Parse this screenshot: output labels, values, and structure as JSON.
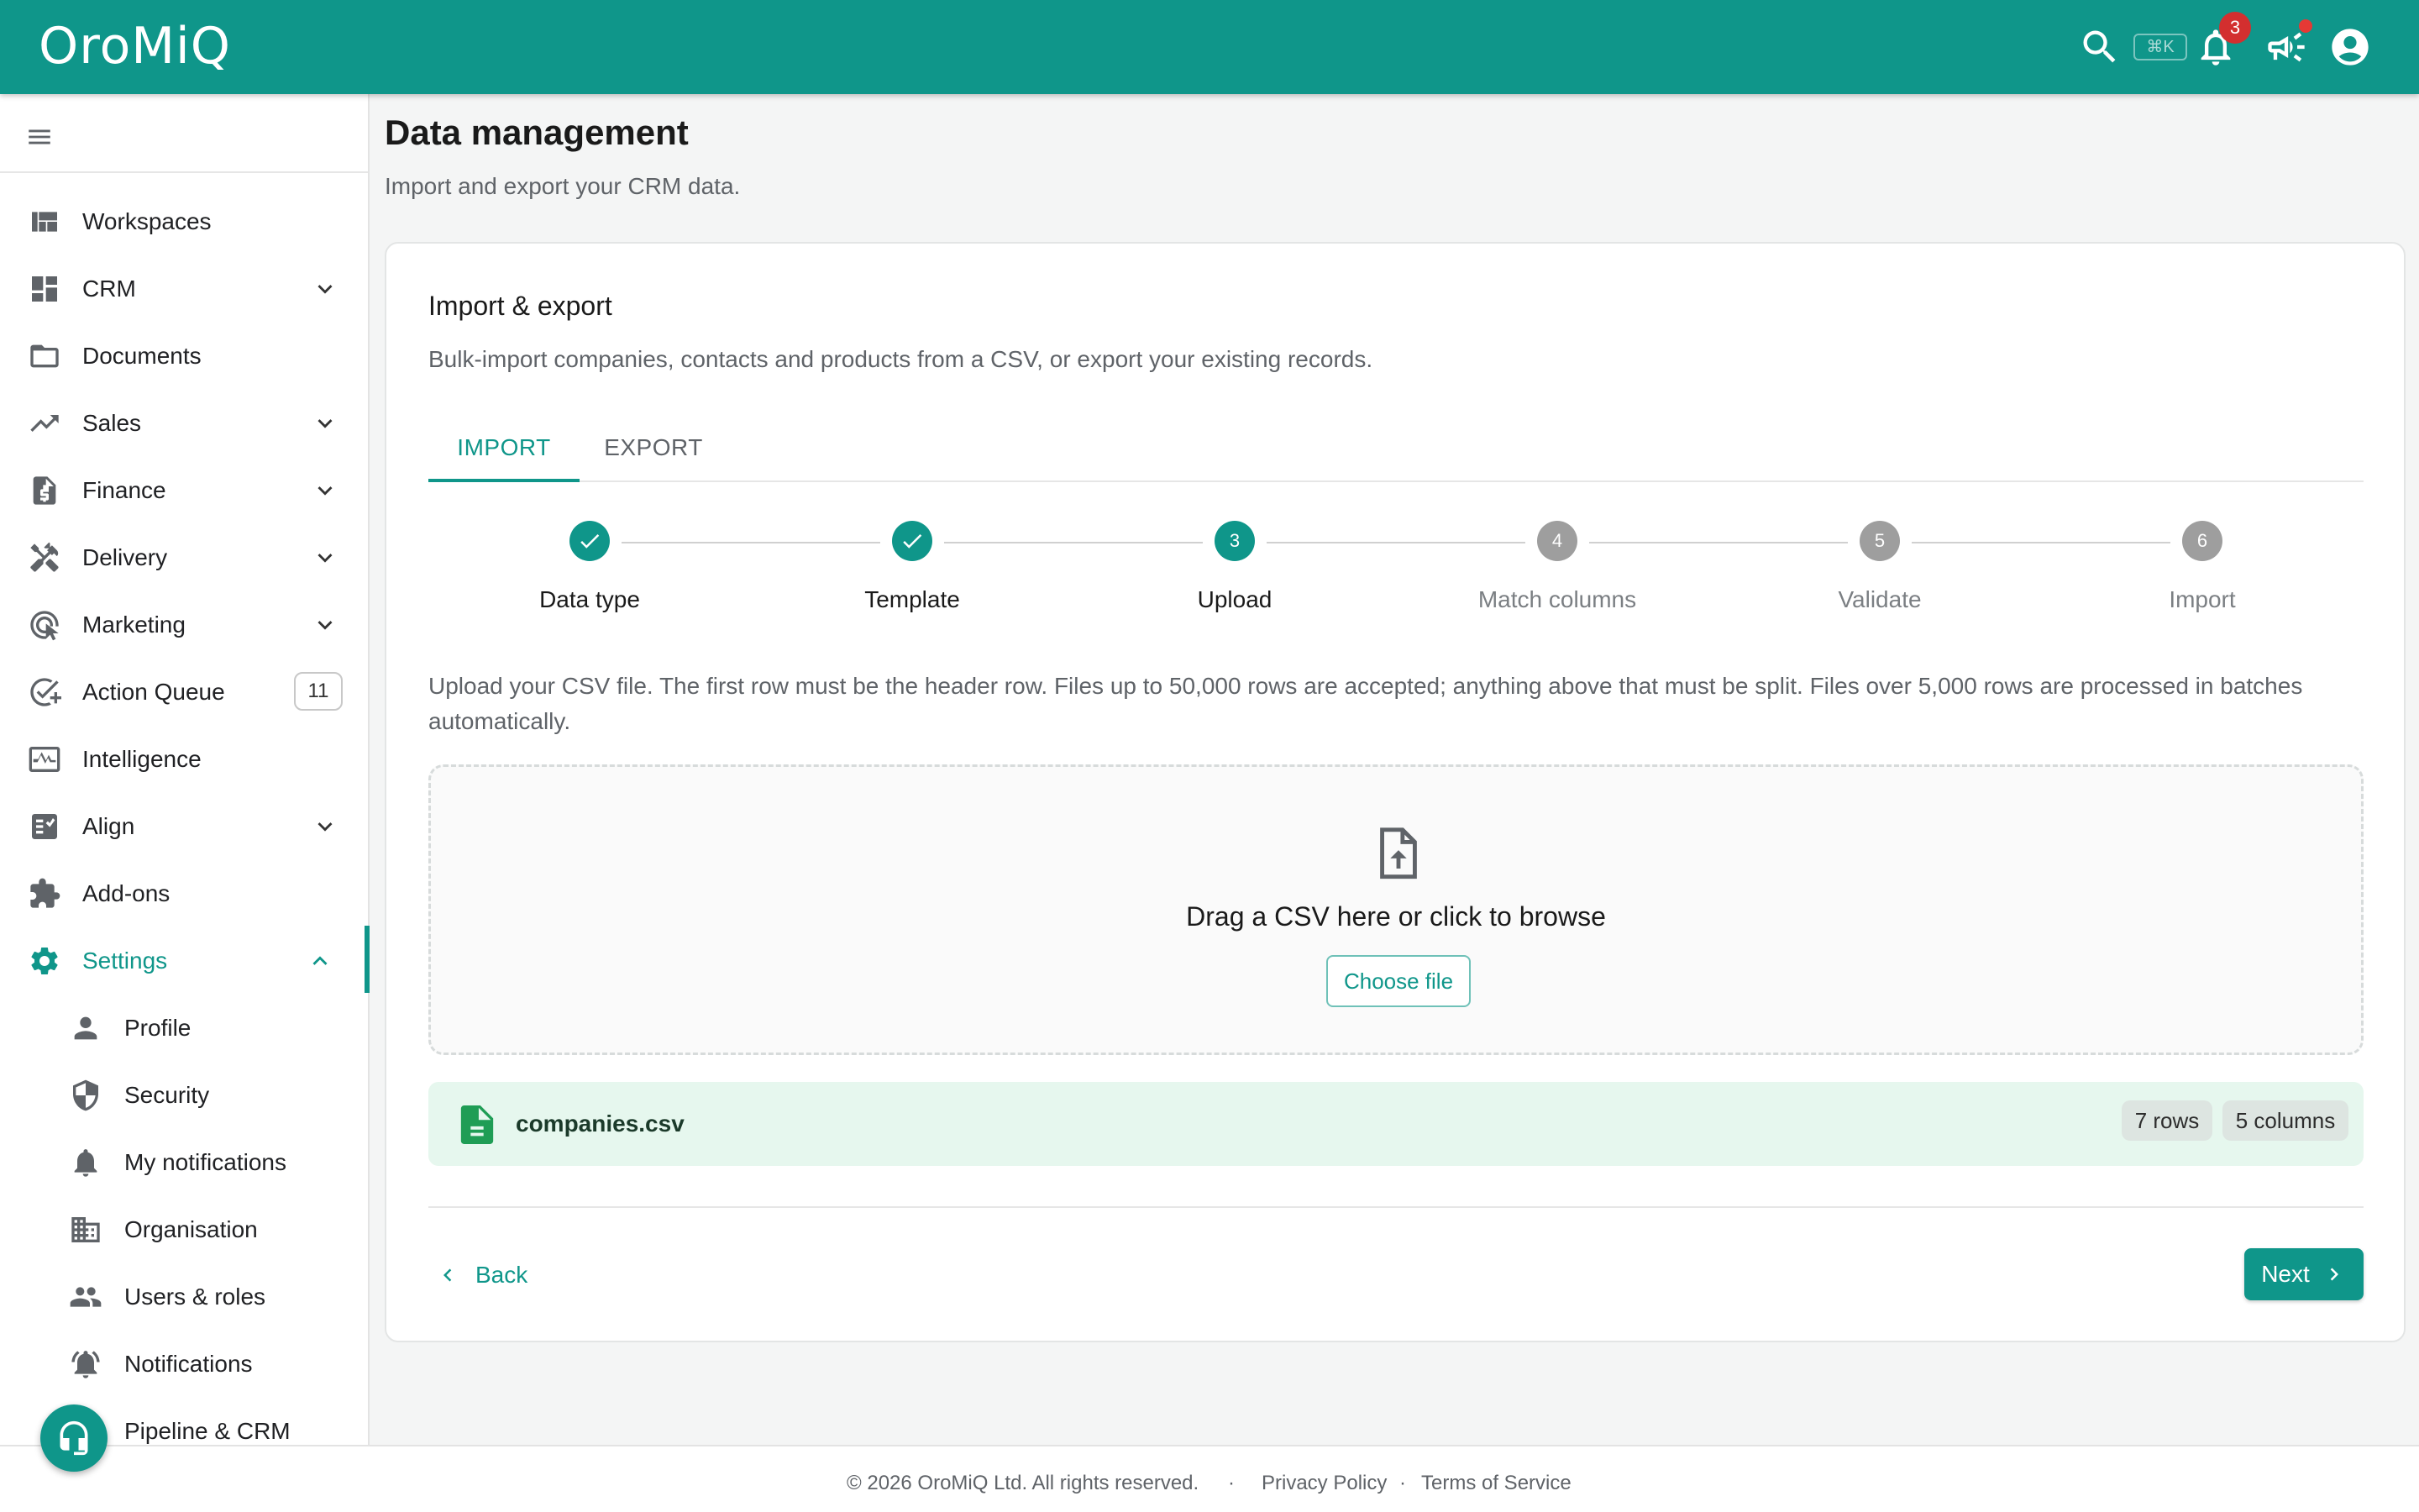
{
  "app": {
    "logo": "OroMiQ"
  },
  "topbar": {
    "shortcut": "⌘K",
    "notification_count": "3",
    "icons": [
      "search-icon",
      "bell-icon",
      "megaphone-icon",
      "account-icon"
    ]
  },
  "sidebar": {
    "items": [
      {
        "label": "Workspaces",
        "icon": "dashboard-icon"
      },
      {
        "label": "CRM",
        "icon": "grid-icon",
        "expandable": true
      },
      {
        "label": "Documents",
        "icon": "folder-icon"
      },
      {
        "label": "Sales",
        "icon": "trending-up-icon",
        "expandable": true
      },
      {
        "label": "Finance",
        "icon": "invoice-icon",
        "expandable": true
      },
      {
        "label": "Delivery",
        "icon": "tools-icon",
        "expandable": true
      },
      {
        "label": "Marketing",
        "icon": "target-icon",
        "expandable": true
      },
      {
        "label": "Action Queue",
        "icon": "check-circle-icon",
        "badge": "11"
      },
      {
        "label": "Intelligence",
        "icon": "pulse-icon"
      },
      {
        "label": "Align",
        "icon": "checklist-icon",
        "expandable": true
      },
      {
        "label": "Add-ons",
        "icon": "puzzle-icon"
      },
      {
        "label": "Settings",
        "icon": "gear-icon",
        "expanded": true,
        "active": true
      }
    ],
    "settings_sub": [
      {
        "label": "Profile",
        "icon": "person-icon"
      },
      {
        "label": "Security",
        "icon": "shield-icon"
      },
      {
        "label": "My notifications",
        "icon": "bell-icon"
      },
      {
        "label": "Organisation",
        "icon": "building-icon"
      },
      {
        "label": "Users & roles",
        "icon": "people-icon"
      },
      {
        "label": "Notifications",
        "icon": "bell-ring-icon"
      },
      {
        "label": "Pipeline & CRM",
        "icon": "pipeline-icon"
      }
    ]
  },
  "page": {
    "title": "Data management",
    "subtitle": "Import and export your CRM data."
  },
  "card": {
    "title": "Import & export",
    "description": "Bulk-import companies, contacts and products from a CSV, or export your existing records.",
    "tabs": [
      {
        "label": "IMPORT",
        "active": true
      },
      {
        "label": "EXPORT",
        "active": false
      }
    ],
    "steps": [
      {
        "number": "1",
        "label": "Data type",
        "state": "done"
      },
      {
        "number": "2",
        "label": "Template",
        "state": "done"
      },
      {
        "number": "3",
        "label": "Upload",
        "state": "current"
      },
      {
        "number": "4",
        "label": "Match columns",
        "state": "todo"
      },
      {
        "number": "5",
        "label": "Validate",
        "state": "todo"
      },
      {
        "number": "6",
        "label": "Import",
        "state": "todo"
      }
    ],
    "upload_info": "Upload your CSV file. The first row must be the header row. Files up to 50,000 rows are accepted; anything above that must be split. Files over 5,000 rows are processed in batches automatically.",
    "dropzone": {
      "text": "Drag a CSV here or click to browse",
      "button": "Choose file"
    },
    "file": {
      "name": "companies.csv",
      "rows": "7 rows",
      "columns": "5 columns"
    },
    "back_label": "Back",
    "next_label": "Next"
  },
  "colors": {
    "brand": "#0f968a",
    "badge": "#d32f2f",
    "file_bg": "#e6f7ee"
  },
  "footer": {
    "copyright": "© 2026 OroMiQ Ltd. All rights reserved.",
    "privacy": "Privacy Policy",
    "terms": "Terms of Service"
  }
}
